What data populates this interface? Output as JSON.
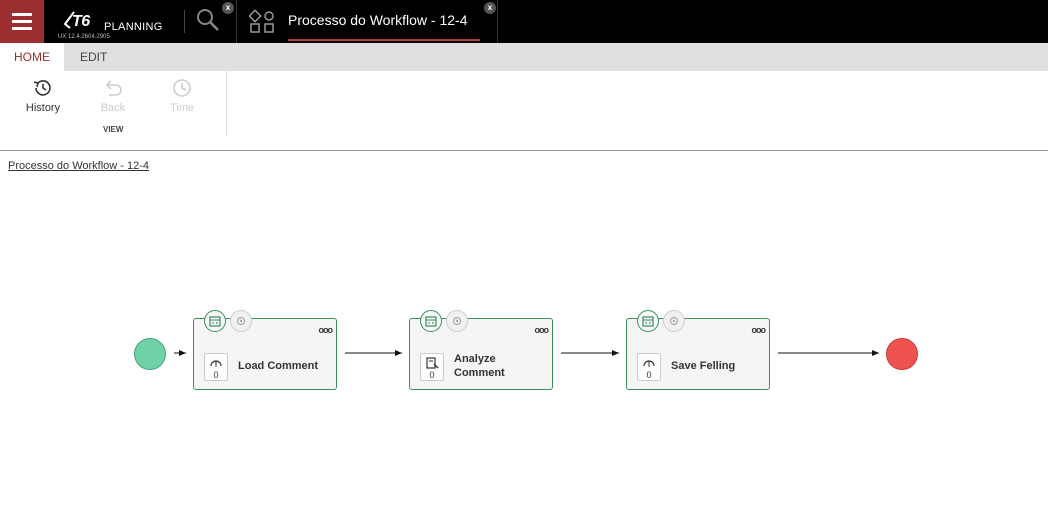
{
  "topbar": {
    "logo_main": "T6",
    "logo_sub": "PLANNING",
    "version": "UX 12.4.2604.2905",
    "tab_title": "Processo do Workflow - 12-4",
    "close_glyph": "x",
    "accent_color": "#9b2f2f"
  },
  "ribbon": {
    "tabs": [
      {
        "label": "HOME",
        "active": true
      },
      {
        "label": "EDIT",
        "active": false
      }
    ],
    "buttons": [
      {
        "label": "History",
        "icon": "history-icon",
        "enabled": true
      },
      {
        "label": "Back",
        "icon": "back-icon",
        "enabled": false
      },
      {
        "label": "Time",
        "icon": "clock-icon",
        "enabled": false
      }
    ],
    "group_label": "VIEW"
  },
  "canvas": {
    "breadcrumb": "Processo do Workflow - 12-4",
    "start_color": "#6fd1a6",
    "end_color": "#ef5350",
    "tasks": [
      {
        "name": "Load Comment",
        "icon": "upload-cloud-icon",
        "count": "0"
      },
      {
        "name": "Analyze Comment",
        "icon": "document-edit-icon",
        "count": "0"
      },
      {
        "name": "Save Felling",
        "icon": "upload-cloud-icon",
        "count": "0"
      }
    ]
  }
}
